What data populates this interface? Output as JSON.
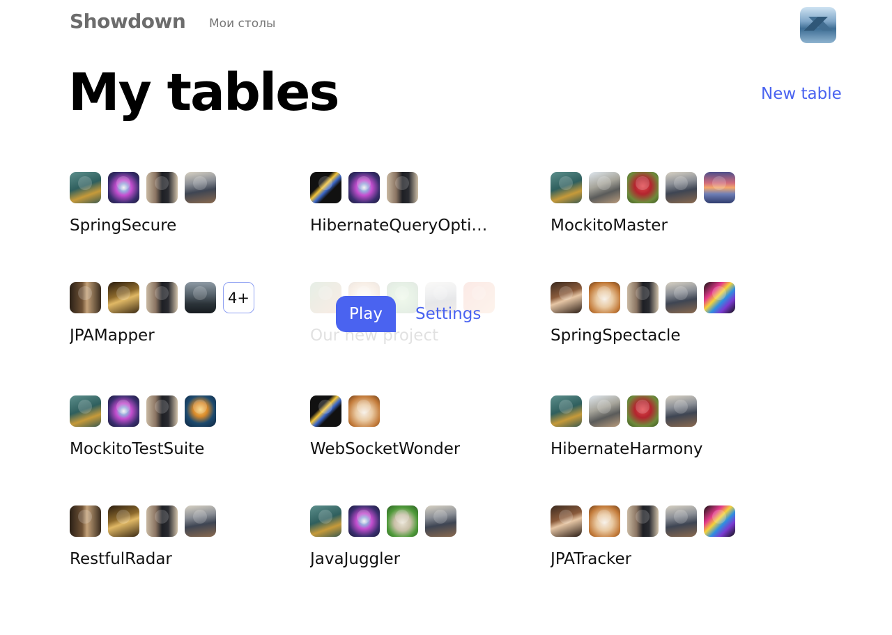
{
  "header": {
    "brand": "Showdown",
    "nav_link": "Мои столы"
  },
  "main": {
    "title": "My tables",
    "new_table_label": "New table"
  },
  "hover": {
    "play_label": "Play",
    "settings_label": "Settings"
  },
  "colors": {
    "accent": "#4a63f0"
  },
  "tables": [
    {
      "name": "SpringSecure",
      "avatars": [
        "teal-forest",
        "aurora-eye",
        "man-portrait",
        "runner-trail"
      ]
    },
    {
      "name": "HibernateQueryOptim..",
      "avatars": [
        "snake-art",
        "aurora-eye",
        "man-portrait"
      ]
    },
    {
      "name": "MockitoMaster",
      "avatars": [
        "teal-forest",
        "motorbike-man",
        "strawberry-snail",
        "runner-trail",
        "sunset-lake"
      ]
    },
    {
      "name": "JPAMapper",
      "avatars": [
        "bearded-man",
        "golden-man",
        "man-portrait",
        "dark-castle"
      ],
      "more": "4+"
    },
    {
      "name": "Our new project",
      "avatars": [
        "green-orange",
        "white-cat",
        "green-ball",
        "runner-trail",
        "red-orange"
      ],
      "hovered": true
    },
    {
      "name": "SpringSpectacle",
      "avatars": [
        "asian-woman",
        "white-cat",
        "man-portrait",
        "runner-trail",
        "colorful-face"
      ]
    },
    {
      "name": "MockitoTestSuite",
      "avatars": [
        "teal-forest",
        "aurora-eye",
        "man-portrait",
        "golden-tree"
      ]
    },
    {
      "name": "WebSocketWonder",
      "avatars": [
        "snake-art",
        "white-cat"
      ]
    },
    {
      "name": "HibernateHarmony",
      "avatars": [
        "teal-forest",
        "motorbike-man",
        "strawberry-snail",
        "runner-trail"
      ]
    },
    {
      "name": "RestfulRadar",
      "avatars": [
        "bearded-man",
        "golden-man",
        "man-portrait",
        "runner-trail"
      ]
    },
    {
      "name": "JavaJuggler",
      "avatars": [
        "teal-forest",
        "aurora-eye",
        "green-hamster",
        "runner-trail"
      ]
    },
    {
      "name": "JPATracker",
      "avatars": [
        "asian-woman",
        "white-cat",
        "man-portrait",
        "runner-trail",
        "colorful-face"
      ]
    }
  ]
}
